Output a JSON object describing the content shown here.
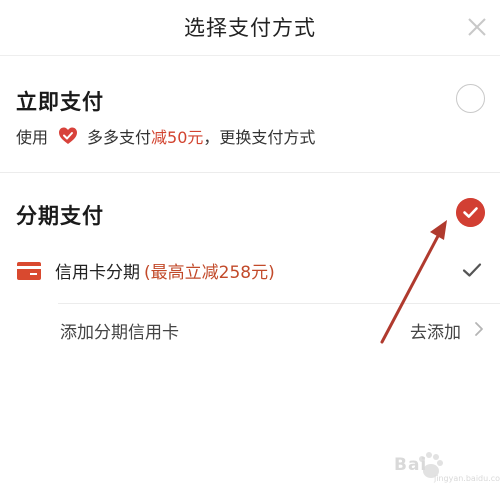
{
  "header": {
    "title": "选择支付方式"
  },
  "instant": {
    "title": "立即支付",
    "desc_prefix": "使用",
    "wallet_name": "多多支付",
    "discount": "减50元",
    "desc_suffix": "，更换支付方式"
  },
  "installment": {
    "title": "分期支付",
    "credit_label": "信用卡分期",
    "credit_promo": "(最高立减258元)",
    "add_label": "添加分期信用卡",
    "add_action": "去添加"
  },
  "watermark": {
    "text": "Bai",
    "text2": "jingyan.baidu.com"
  },
  "colors": {
    "accent": "#d23f33",
    "promo": "#c24a2a",
    "annotation_arrow": "#b03a2e"
  }
}
